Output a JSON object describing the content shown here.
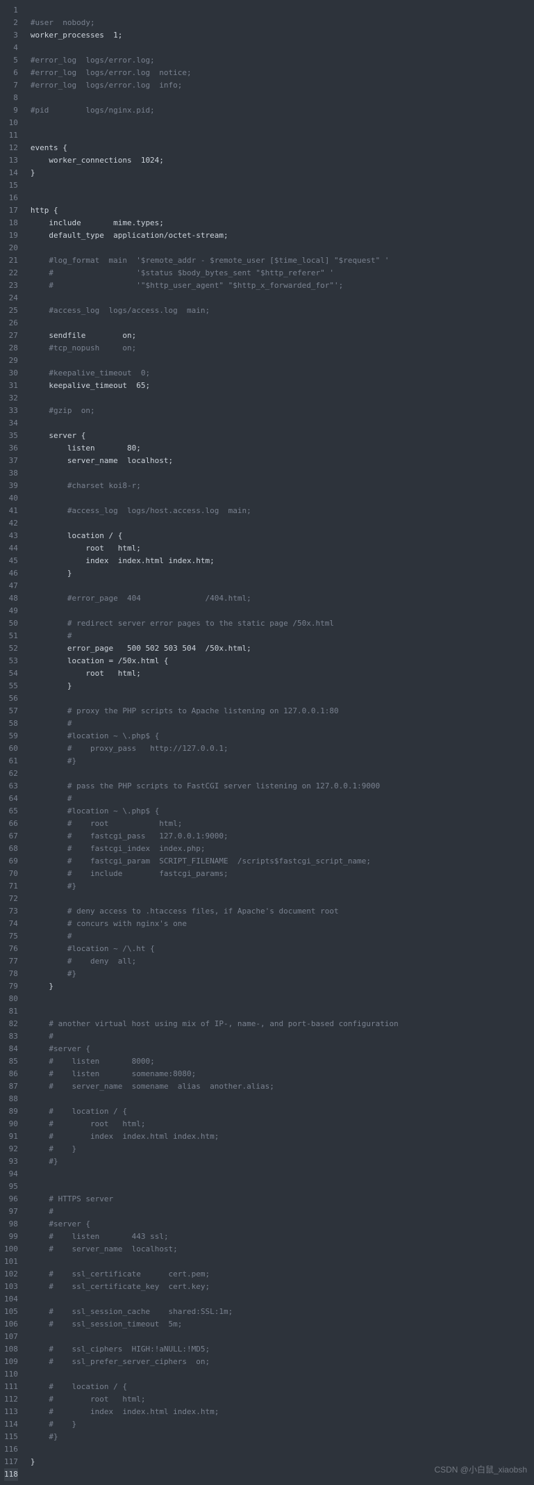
{
  "watermark": "CSDN @小白鼠_xiaobsh",
  "total_lines": 118,
  "active_line": 118,
  "code_lines": [
    "",
    "#user  nobody;",
    "worker_processes  1;",
    "",
    "#error_log  logs/error.log;",
    "#error_log  logs/error.log  notice;",
    "#error_log  logs/error.log  info;",
    "",
    "#pid        logs/nginx.pid;",
    "",
    "",
    "events {",
    "    worker_connections  1024;",
    "}",
    "",
    "",
    "http {",
    "    include       mime.types;",
    "    default_type  application/octet-stream;",
    "",
    "    #log_format  main  '$remote_addr - $remote_user [$time_local] \"$request\" '",
    "    #                  '$status $body_bytes_sent \"$http_referer\" '",
    "    #                  '\"$http_user_agent\" \"$http_x_forwarded_for\"';",
    "",
    "    #access_log  logs/access.log  main;",
    "",
    "    sendfile        on;",
    "    #tcp_nopush     on;",
    "",
    "    #keepalive_timeout  0;",
    "    keepalive_timeout  65;",
    "",
    "    #gzip  on;",
    "",
    "    server {",
    "        listen       80;",
    "        server_name  localhost;",
    "",
    "        #charset koi8-r;",
    "",
    "        #access_log  logs/host.access.log  main;",
    "",
    "        location / {",
    "            root   html;",
    "            index  index.html index.htm;",
    "        }",
    "",
    "        #error_page  404              /404.html;",
    "",
    "        # redirect server error pages to the static page /50x.html",
    "        #",
    "        error_page   500 502 503 504  /50x.html;",
    "        location = /50x.html {",
    "            root   html;",
    "        }",
    "",
    "        # proxy the PHP scripts to Apache listening on 127.0.0.1:80",
    "        #",
    "        #location ~ \\.php$ {",
    "        #    proxy_pass   http://127.0.0.1;",
    "        #}",
    "",
    "        # pass the PHP scripts to FastCGI server listening on 127.0.0.1:9000",
    "        #",
    "        #location ~ \\.php$ {",
    "        #    root           html;",
    "        #    fastcgi_pass   127.0.0.1:9000;",
    "        #    fastcgi_index  index.php;",
    "        #    fastcgi_param  SCRIPT_FILENAME  /scripts$fastcgi_script_name;",
    "        #    include        fastcgi_params;",
    "        #}",
    "",
    "        # deny access to .htaccess files, if Apache's document root",
    "        # concurs with nginx's one",
    "        #",
    "        #location ~ /\\.ht {",
    "        #    deny  all;",
    "        #}",
    "    }",
    "",
    "",
    "    # another virtual host using mix of IP-, name-, and port-based configuration",
    "    #",
    "    #server {",
    "    #    listen       8000;",
    "    #    listen       somename:8080;",
    "    #    server_name  somename  alias  another.alias;",
    "",
    "    #    location / {",
    "    #        root   html;",
    "    #        index  index.html index.htm;",
    "    #    }",
    "    #}",
    "",
    "",
    "    # HTTPS server",
    "    #",
    "    #server {",
    "    #    listen       443 ssl;",
    "    #    server_name  localhost;",
    "",
    "    #    ssl_certificate      cert.pem;",
    "    #    ssl_certificate_key  cert.key;",
    "",
    "    #    ssl_session_cache    shared:SSL:1m;",
    "    #    ssl_session_timeout  5m;",
    "",
    "    #    ssl_ciphers  HIGH:!aNULL:!MD5;",
    "    #    ssl_prefer_server_ciphers  on;",
    "",
    "    #    location / {",
    "    #        root   html;",
    "    #        index  index.html index.htm;",
    "    #    }",
    "    #}",
    "",
    "}",
    ""
  ]
}
